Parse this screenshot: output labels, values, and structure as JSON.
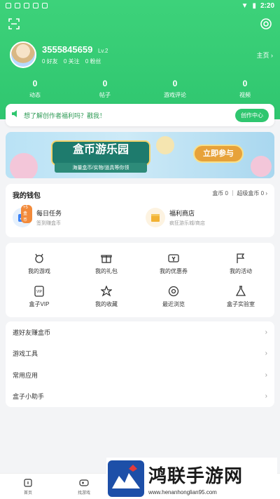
{
  "status_bar": {
    "time": "2:20"
  },
  "profile": {
    "username": "3555845659",
    "level": "Lv.2",
    "friends": "0 好友",
    "following": "0 关注",
    "fans": "0 粉丝",
    "home_link": "主页 ›"
  },
  "stats": [
    {
      "value": "0",
      "label": "动态"
    },
    {
      "value": "0",
      "label": "帖子"
    },
    {
      "value": "0",
      "label": "游戏评论"
    },
    {
      "value": "0",
      "label": "视频"
    }
  ],
  "notice": {
    "text": "想了解创作者福利吗？戳我！",
    "button": "创作中心"
  },
  "banner": {
    "title": "盒币游乐园",
    "subtitle": "海量盒币/实物/道具等你领",
    "button": "立即参与"
  },
  "wallet": {
    "title": "我的钱包",
    "coins": "盒币 0 ｜ 超级盒币 0 ›",
    "items": [
      {
        "name": "每日任务",
        "desc": "签到赚盒币",
        "tag": "+5盒币"
      },
      {
        "name": "福利商店",
        "desc": "疯狂游乐城/商店"
      }
    ]
  },
  "grid": [
    {
      "label": "我的游戏",
      "icon": "gamepad-icon"
    },
    {
      "label": "我的礼包",
      "icon": "gift-icon"
    },
    {
      "label": "我的优惠券",
      "icon": "coupon-icon"
    },
    {
      "label": "我的活动",
      "icon": "flag-icon"
    },
    {
      "label": "盒子VIP",
      "icon": "vip-icon"
    },
    {
      "label": "我的收藏",
      "icon": "star-icon"
    },
    {
      "label": "最近浏览",
      "icon": "eye-icon"
    },
    {
      "label": "盒子实验室",
      "icon": "flask-icon"
    }
  ],
  "list": [
    {
      "label": "邀好友赚盒币"
    },
    {
      "label": "游戏工具"
    },
    {
      "label": "常用应用"
    },
    {
      "label": "盒子小助手"
    }
  ],
  "tabs": [
    {
      "label": "首页"
    },
    {
      "label": "找游戏"
    }
  ],
  "watermark": {
    "brand": "鸿联手游网",
    "url": "www.henanhonglian95.com"
  },
  "colors": {
    "accent": "#2fc66f",
    "banner_button": "#e7a23a"
  }
}
